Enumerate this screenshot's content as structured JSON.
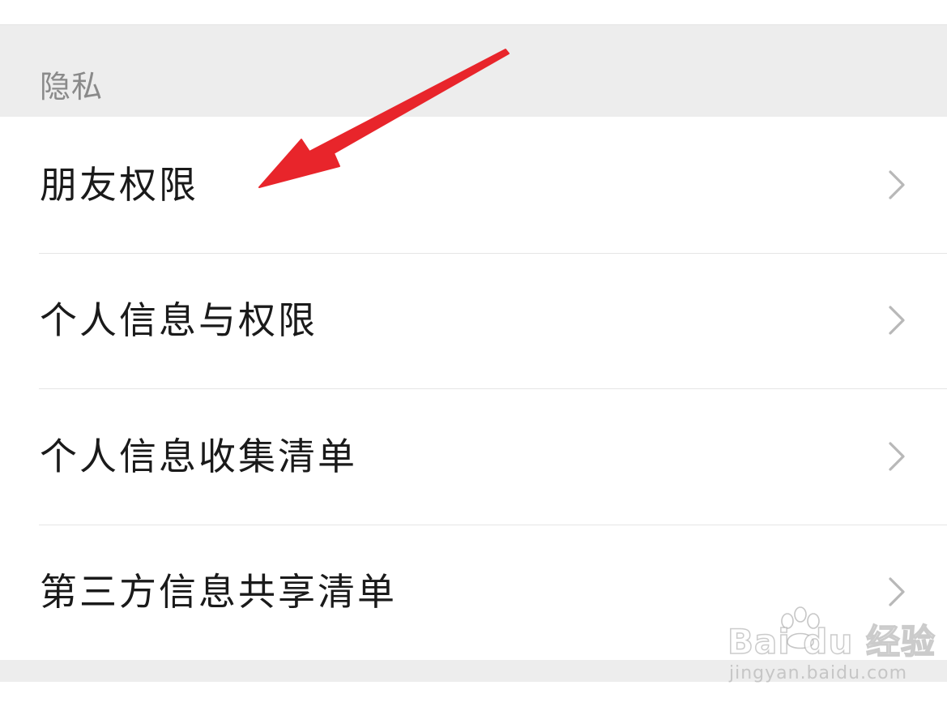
{
  "section": {
    "title": "隐私"
  },
  "menu": {
    "items": [
      {
        "label": "朋友权限"
      },
      {
        "label": "个人信息与权限"
      },
      {
        "label": "个人信息收集清单"
      },
      {
        "label": "第三方信息共享清单"
      }
    ]
  },
  "icons": {
    "chevron": "chevron-right-icon",
    "annotation": "red-arrow-annotation"
  },
  "watermark": {
    "logo": "Bai du 经验",
    "url": "jingyan.baidu.com"
  },
  "colors": {
    "annotation": "#e8252b",
    "background": "#ededed",
    "surface": "#ffffff",
    "text_primary": "#1a1a1a",
    "text_secondary": "#8a8a8a",
    "chevron": "#b8b8b8"
  }
}
